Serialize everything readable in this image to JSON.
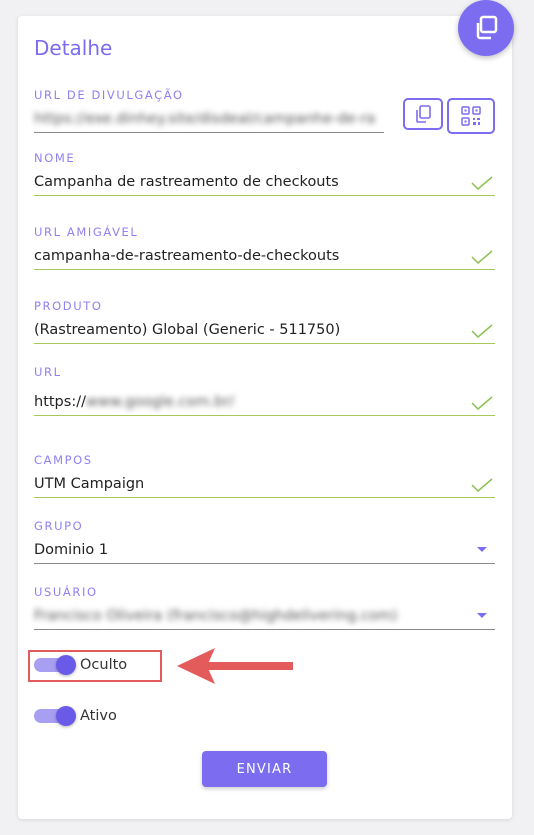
{
  "title": "Detalhe",
  "fields": {
    "url_divulgacao": {
      "label": "URL DE DIVULGAÇÃO",
      "value": "https://exe.dinhey.site/disdeal/campanhe-de-rastreamento"
    },
    "nome": {
      "label": "NOME",
      "value": "Campanha de rastreamento de checkouts"
    },
    "url_amigavel": {
      "label": "URL AMIGÁVEL",
      "value": "campanha-de-rastreamento-de-checkouts"
    },
    "produto": {
      "label": "PRODUTO",
      "value": "(Rastreamento) Global (Generic - 511750)"
    },
    "url": {
      "label": "URL",
      "value_prefix": "https://",
      "value_blurred": "www.google.com.br/"
    },
    "campos": {
      "label": "CAMPOS",
      "value": "UTM Campaign"
    },
    "grupo": {
      "label": "GRUPO",
      "value": "Dominio 1"
    },
    "usuario": {
      "label": "USUÁRIO",
      "value": "Francisco Oliveira (francisco@highdelivering.com)"
    }
  },
  "toggles": {
    "oculto": {
      "label": "Oculto",
      "on": true
    },
    "ativo": {
      "label": "Ativo",
      "on": true
    }
  },
  "submit_label": "ENVIAR",
  "colors": {
    "accent": "#7b6cf0",
    "valid_underline": "#a8c95a",
    "highlight": "#e45b5b"
  }
}
